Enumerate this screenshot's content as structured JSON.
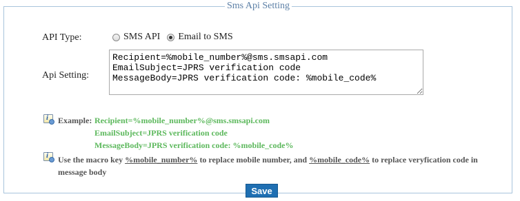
{
  "fieldset": {
    "legend": "Sms Api Setting"
  },
  "api_type": {
    "label": "API Type:",
    "options": [
      {
        "label": "SMS API",
        "checked": false
      },
      {
        "label": "Email to SMS",
        "checked": true
      }
    ]
  },
  "api_setting": {
    "label": "Api Setting:",
    "value": "Recipient=%mobile_number%@sms.smsapi.com\nEmailSubject=JPRS verification code\nMessageBody=JPRS verification code: %mobile_code%"
  },
  "example": {
    "key": "Example:",
    "line1": "Recipient=%mobile_number%@sms.smsapi.com",
    "line2": "EmailSubject=JPRS verification code",
    "line3": "MessageBody=JPRS verification code: %mobile_code%"
  },
  "note": {
    "prefix": "Use the macro key ",
    "macro1": "%mobile_number%",
    "middle": " to replace mobile number, and ",
    "macro2": "%mobile_code%",
    "suffix": " to replace veryfication code in message body"
  },
  "save_label": "Save"
}
